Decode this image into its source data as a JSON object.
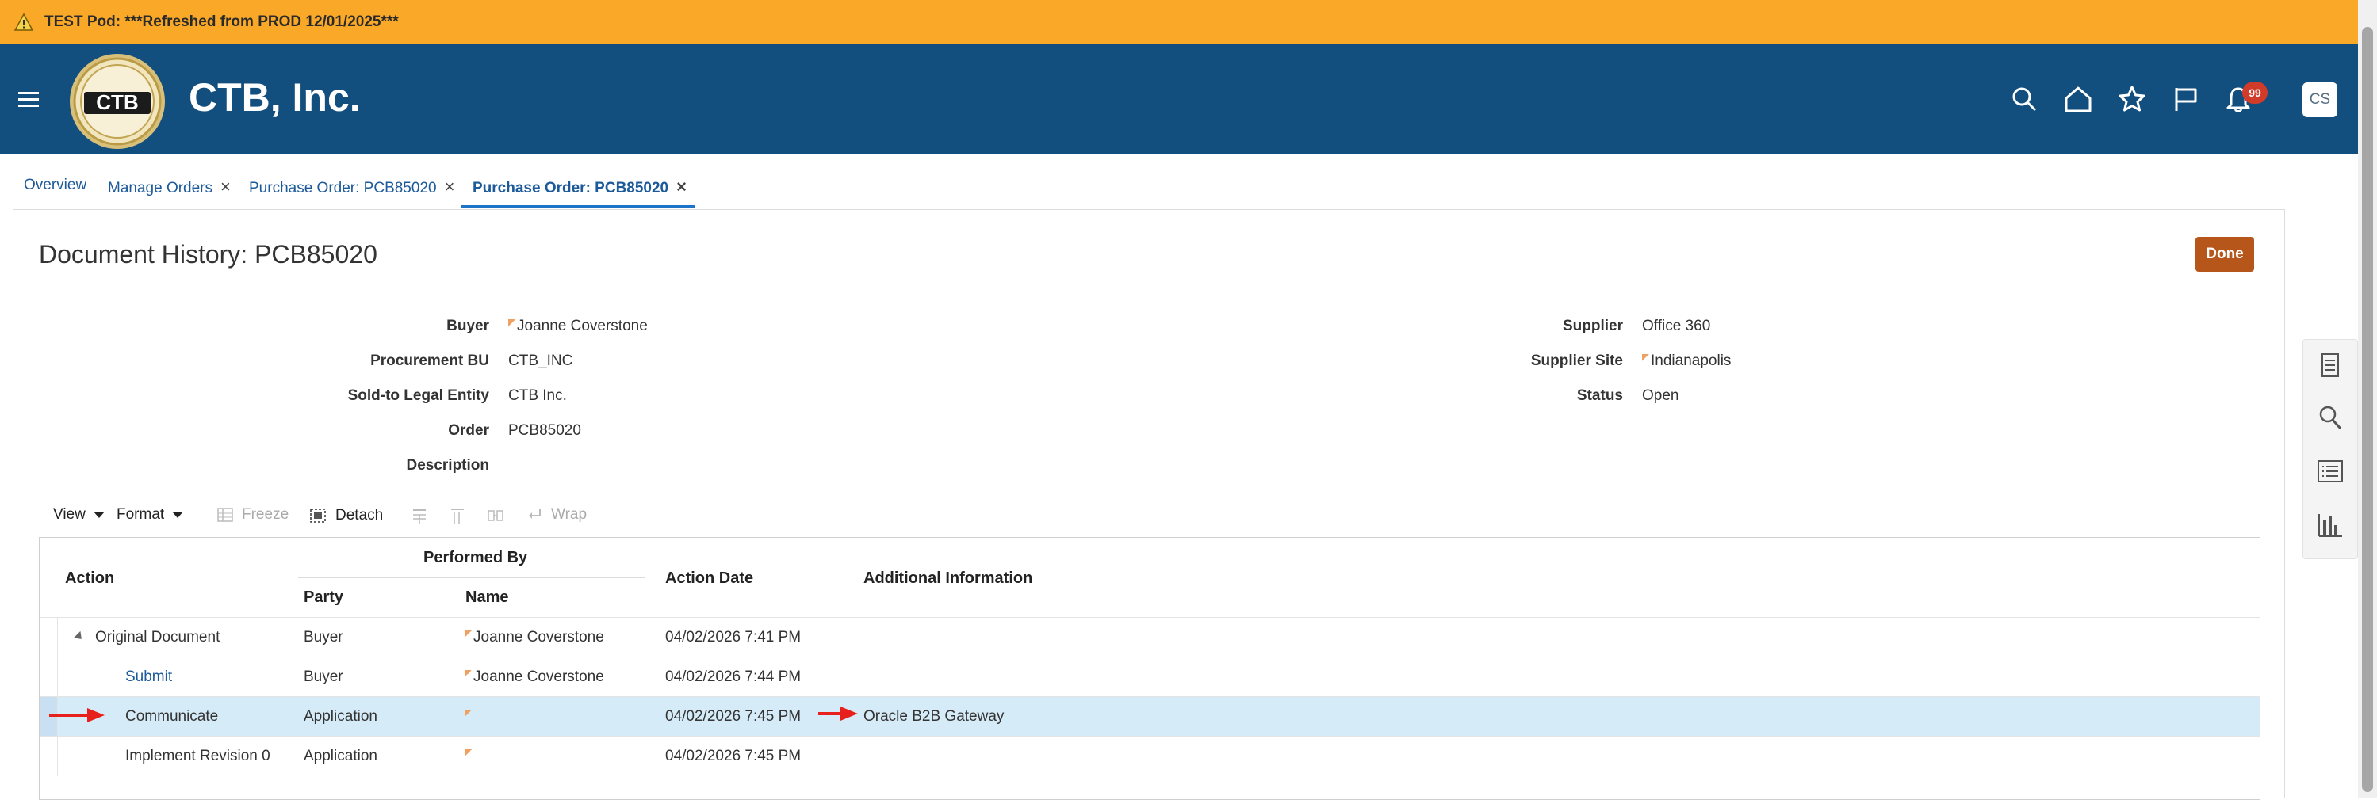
{
  "banner": {
    "text": "TEST Pod: ***Refreshed from PROD 12/01/2025***"
  },
  "header": {
    "brand": "CTB, Inc.",
    "logo_text": "CTB",
    "notifications_count": "99",
    "avatar_initials": "CS"
  },
  "tabs": [
    {
      "label": "Overview",
      "closable": false
    },
    {
      "label": "Manage Orders",
      "closable": true
    },
    {
      "label": "Purchase Order: PCB85020",
      "closable": true
    },
    {
      "label": "Purchase Order: PCB85020",
      "closable": true,
      "active": true
    }
  ],
  "page": {
    "title": "Document History: PCB85020",
    "done_label": "Done"
  },
  "fields_left": [
    {
      "label": "Buyer",
      "value": "Joanne Coverstone",
      "flag": true
    },
    {
      "label": "Procurement BU",
      "value": "CTB_INC"
    },
    {
      "label": "Sold-to Legal Entity",
      "value": "CTB Inc."
    },
    {
      "label": "Order",
      "value": "PCB85020"
    },
    {
      "label": "Description",
      "value": ""
    }
  ],
  "fields_right": [
    {
      "label": "Supplier",
      "value": "Office 360"
    },
    {
      "label": "Supplier Site",
      "value": "Indianapolis",
      "flag": true
    },
    {
      "label": "Status",
      "value": "Open"
    }
  ],
  "toolbar": {
    "view": "View",
    "format": "Format",
    "freeze": "Freeze",
    "detach": "Detach",
    "wrap": "Wrap"
  },
  "table": {
    "headers": {
      "action": "Action",
      "performed_by": "Performed By",
      "party": "Party",
      "name": "Name",
      "action_date": "Action Date",
      "additional_info": "Additional Information"
    },
    "rows": [
      {
        "action": "Original Document",
        "party": "Buyer",
        "name": "Joanne Coverstone",
        "date": "04/02/2026 7:41 PM",
        "info": "",
        "expandable": true
      },
      {
        "action": "Submit",
        "party": "Buyer",
        "name": "Joanne Coverstone",
        "date": "04/02/2026 7:44 PM",
        "info": "",
        "link": true
      },
      {
        "action": "Communicate",
        "party": "Application",
        "name": "",
        "date": "04/02/2026 7:45 PM",
        "info": "Oracle B2B Gateway",
        "selected": true
      },
      {
        "action": "Implement Revision 0",
        "party": "Application",
        "name": "",
        "date": "04/02/2026 7:45 PM",
        "info": ""
      }
    ]
  },
  "colors": {
    "banner": "#f9a828",
    "header": "#124e7e",
    "done_button": "#b6561b",
    "selected_row": "#d6ebf8",
    "link": "#1c5a9a",
    "annotation_arrow": "#e8201c"
  }
}
